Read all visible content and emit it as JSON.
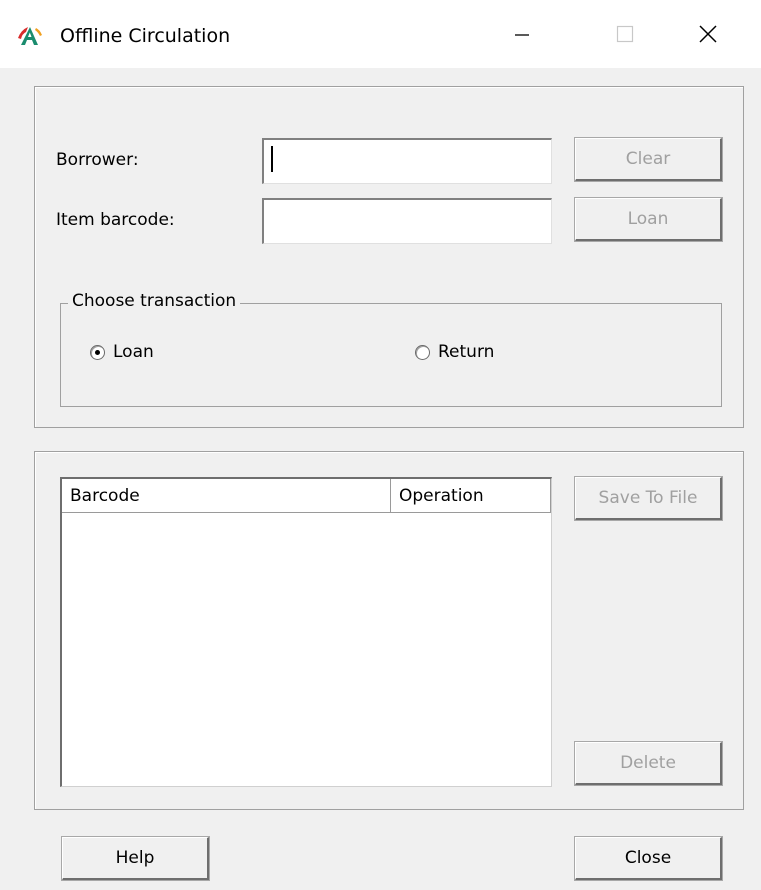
{
  "window": {
    "title": "Offline Circulation",
    "min_glyph": "—",
    "max_glyph": "☐",
    "close_glyph": "✕"
  },
  "form": {
    "borrower_label": "Borrower:",
    "borrower_value": "",
    "item_label": "Item barcode:",
    "item_value": "",
    "clear_label": "Clear",
    "loan_button_label": "Loan"
  },
  "transaction": {
    "legend": "Choose transaction",
    "options": [
      {
        "label": "Loan",
        "selected": true
      },
      {
        "label": "Return",
        "selected": false
      }
    ]
  },
  "list": {
    "columns": [
      "Barcode",
      "Operation"
    ],
    "rows": []
  },
  "actions": {
    "save_label": "Save To File",
    "delete_label": "Delete",
    "help_label": "Help",
    "close_label": "Close"
  }
}
